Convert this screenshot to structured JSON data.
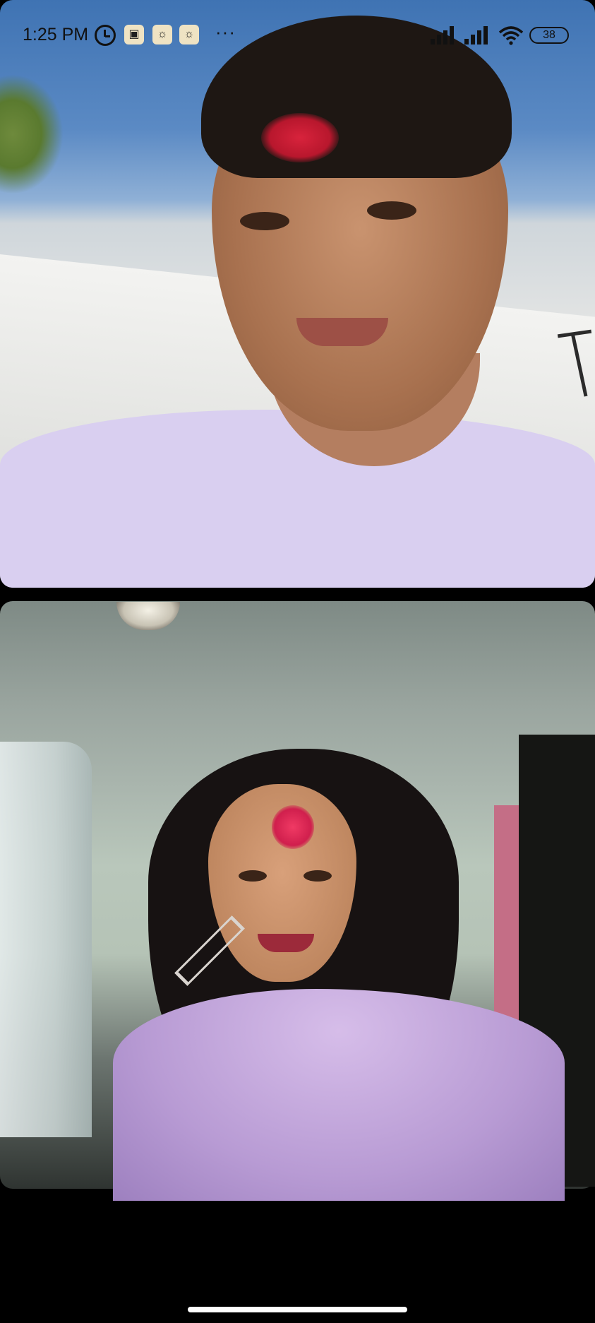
{
  "status_bar": {
    "time": "1:25 PM",
    "icons": [
      "alarm-icon",
      "instagram-icon",
      "snapchat-icon",
      "snapchat-icon"
    ],
    "more": "···",
    "signal_1": "signal-icon",
    "signal_2": "signal-icon",
    "wifi": "wifi-icon",
    "battery": "38"
  },
  "video_call": {
    "remote_feed": "remote-video",
    "local_feed": "self-view-video"
  },
  "colors": {
    "status_text": "#111111",
    "background": "#000000",
    "home_indicator": "#ffffff"
  }
}
